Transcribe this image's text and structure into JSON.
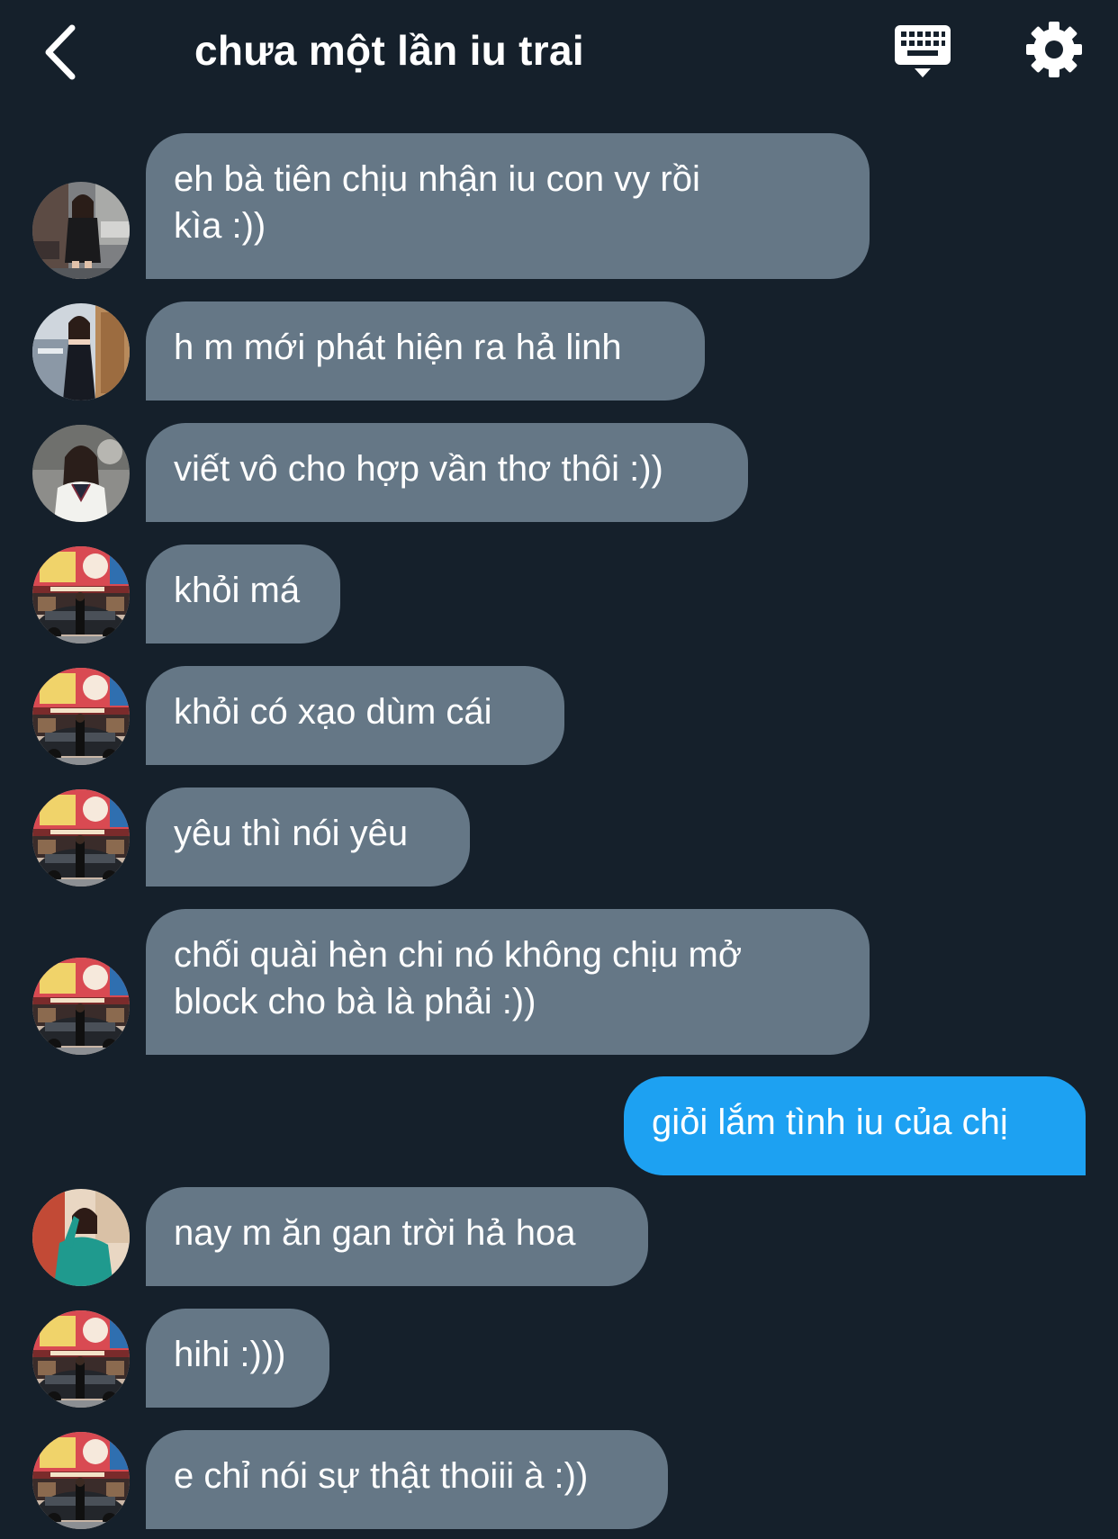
{
  "header": {
    "title": "chưa một lần iu trai",
    "back_icon": "chevron-left-icon",
    "keyboard_icon": "keyboard-icon",
    "settings_icon": "gear-icon"
  },
  "colors": {
    "background": "#15202b",
    "received_bubble": "#657786",
    "sent_bubble": "#1da1f2",
    "text": "#ffffff"
  },
  "messages": [
    {
      "direction": "received",
      "avatar": "avatar-woman-black-outfit-street",
      "text": "eh bà tiên chịu nhận iu con vy rồi\nkìa :))"
    },
    {
      "direction": "received",
      "avatar": "avatar-woman-black-dress-city",
      "text": "h m mới phát hiện ra hả linh"
    },
    {
      "direction": "received",
      "avatar": "avatar-woman-school-uniform",
      "text": "viết vô cho hợp vần thơ thôi :))"
    },
    {
      "direction": "received",
      "avatar": "avatar-colorful-storefront-car",
      "text": "khỏi má"
    },
    {
      "direction": "received",
      "avatar": "avatar-colorful-storefront-car",
      "text": "khỏi có xạo dùm cái"
    },
    {
      "direction": "received",
      "avatar": "avatar-colorful-storefront-car",
      "text": "yêu thì nói yêu"
    },
    {
      "direction": "received",
      "avatar": "avatar-colorful-storefront-car",
      "text": "chối quài hèn chi nó không chịu mở\nblock cho bà là phải :))"
    },
    {
      "direction": "sent",
      "text": "giỏi lắm tình iu của chị"
    },
    {
      "direction": "received",
      "avatar": "avatar-woman-teal-dress",
      "text": "nay m ăn gan trời hả hoa"
    },
    {
      "direction": "received",
      "avatar": "avatar-colorful-storefront-car",
      "text": "hihi :)))"
    },
    {
      "direction": "received",
      "avatar": "avatar-colorful-storefront-car",
      "text": "e chỉ nói sự thật thoiii à :))"
    }
  ]
}
